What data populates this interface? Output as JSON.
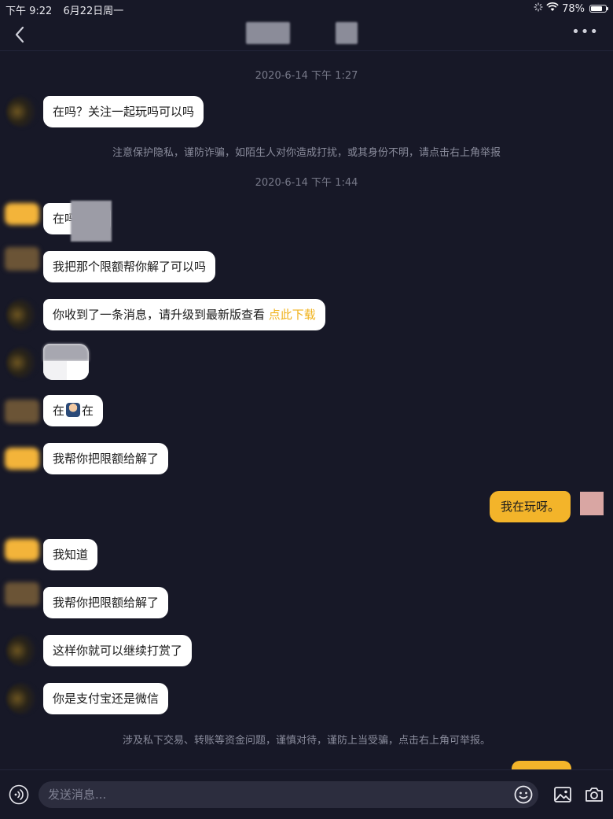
{
  "status": {
    "time": "下午 9:22",
    "date": "6月22日周一",
    "battery": "78%",
    "battery_level": 0.78
  },
  "nav": {
    "back_icon": "chevron-left-icon",
    "more_icon": "more-horizontal-icon"
  },
  "chat": {
    "timestamp_1": "2020-6-14 下午 1:27",
    "msg_1": "在吗？关注一起玩吗可以吗",
    "privacy_notice": "注意保护隐私，谨防诈骗，如陌生人对你造成打扰，或其身份不明，请点击右上角举报",
    "timestamp_2": "2020-6-14 下午 1:44",
    "msg_2": "在吗",
    "msg_3": "我把那个限额帮你解了可以吗",
    "msg_4_text": "你收到了一条消息，请升级到最新版查看",
    "msg_4_link": "点此下载",
    "msg_6_a": "在",
    "msg_6_b": "在",
    "msg_7": "我帮你把限额给解了",
    "msg_8_self": "我在玩呀。",
    "msg_9": "我知道",
    "msg_10": "我帮你把限额给解了",
    "msg_11": "这样你就可以继续打赏了",
    "msg_12": "你是支付宝还是微信",
    "finance_notice": "涉及私下交易、转账等资金问题，谨慎对待，谨防上当受骗，点击右上角可举报。"
  },
  "input": {
    "placeholder": "发送消息...",
    "voice_icon": "voice-icon",
    "emoji_icon": "emoji-icon",
    "image_icon": "image-icon",
    "camera_icon": "camera-icon"
  },
  "colors": {
    "background": "#171827",
    "accent": "#f3b42a",
    "bubble_incoming": "#ffffff",
    "link": "#f0b21b"
  }
}
